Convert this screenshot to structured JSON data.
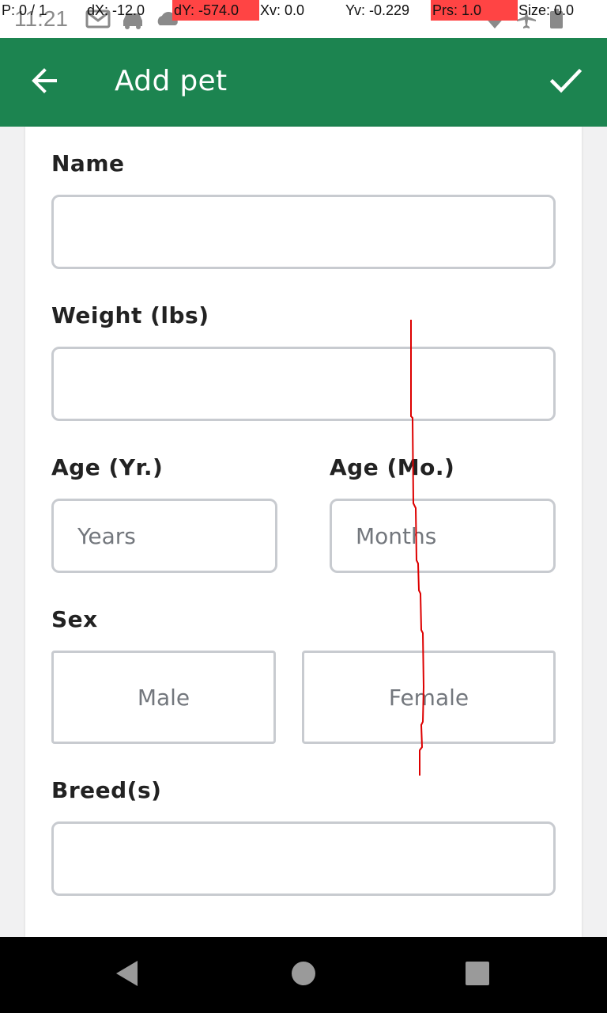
{
  "status_bar": {
    "time": "11:21",
    "icons": [
      "gmail-icon",
      "car-icon",
      "cloud-icon",
      "wifi-icon",
      "airplane-icon",
      "battery-icon"
    ]
  },
  "pointer_overlay": {
    "p": "P: 0 / 1",
    "dx": "dX: -12.0",
    "dy": "dY: -574.0",
    "xv": "Xv: 0.0",
    "yv": "Yv: -0.229",
    "prs": "Prs: 1.0",
    "size": "Size: 0.0",
    "highlight_color": "#ff4444"
  },
  "app_bar": {
    "title": "Add pet",
    "back_icon": "arrow-left-icon",
    "confirm_icon": "check-icon",
    "color": "#1c8450"
  },
  "form": {
    "name": {
      "label": "Name",
      "value": "",
      "placeholder": ""
    },
    "weight": {
      "label": "Weight (lbs)",
      "value": "",
      "placeholder": ""
    },
    "age_years": {
      "label": "Age (Yr.)",
      "value": "",
      "placeholder": "Years"
    },
    "age_months": {
      "label": "Age (Mo.)",
      "value": "",
      "placeholder": "Months"
    },
    "sex": {
      "label": "Sex",
      "options": [
        "Male",
        "Female"
      ]
    },
    "breeds": {
      "label": "Breed(s)",
      "value": "",
      "placeholder": ""
    }
  },
  "nav_bar": {
    "icons": [
      "back-triangle-icon",
      "home-circle-icon",
      "recents-square-icon"
    ]
  },
  "colors": {
    "accent": "#1c8450",
    "input_border": "#c8cbd0",
    "placeholder": "#73777d",
    "trace": "#dd0000"
  }
}
